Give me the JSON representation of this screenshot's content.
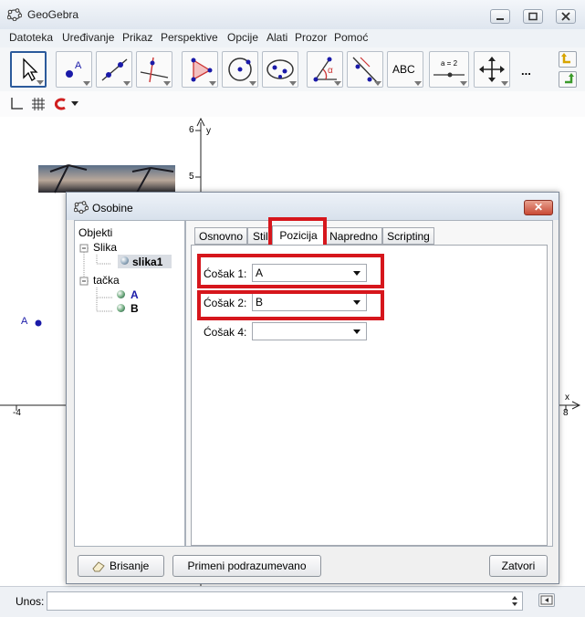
{
  "app": {
    "title": "GeoGebra"
  },
  "menu": [
    "Datoteka",
    "Uređivanje",
    "Prikaz",
    "Perspektive",
    "Opcije",
    "Alati",
    "Prozor",
    "Pomoć"
  ],
  "toolbar": {
    "abc_label": "ABC",
    "slider_label": "a = 2",
    "more_label": "..."
  },
  "graphics": {
    "y_axis_label": "y",
    "x_axis_label": "x",
    "y_ticks": [
      "6",
      "5"
    ],
    "x_ticks": [
      "-4",
      "8"
    ],
    "point_label": "A"
  },
  "dialog": {
    "title": "Osobine",
    "tree": {
      "root": "Objekti",
      "group1": "Slika",
      "item1": "slika1",
      "group2": "tačka",
      "item2": "A",
      "item3": "B"
    },
    "tabs": [
      "Osnovno",
      "Stil",
      "Pozicija",
      "Napredno",
      "Scripting"
    ],
    "active_tab": "Pozicija",
    "fields": [
      {
        "label": "Ćošak 1:",
        "value": "A"
      },
      {
        "label": "Ćošak 2:",
        "value": "B"
      },
      {
        "label": "Ćošak 4:",
        "value": ""
      }
    ],
    "buttons": {
      "delete": "Brisanje",
      "apply_default": "Primeni podrazumevano",
      "close": "Zatvori"
    },
    "close_glyph": "✕"
  },
  "input_bar": {
    "label": "Unos:"
  },
  "colors": {
    "highlight": "#d6161c",
    "point": "#1a1aa8",
    "accent": "#2b5a9b"
  }
}
